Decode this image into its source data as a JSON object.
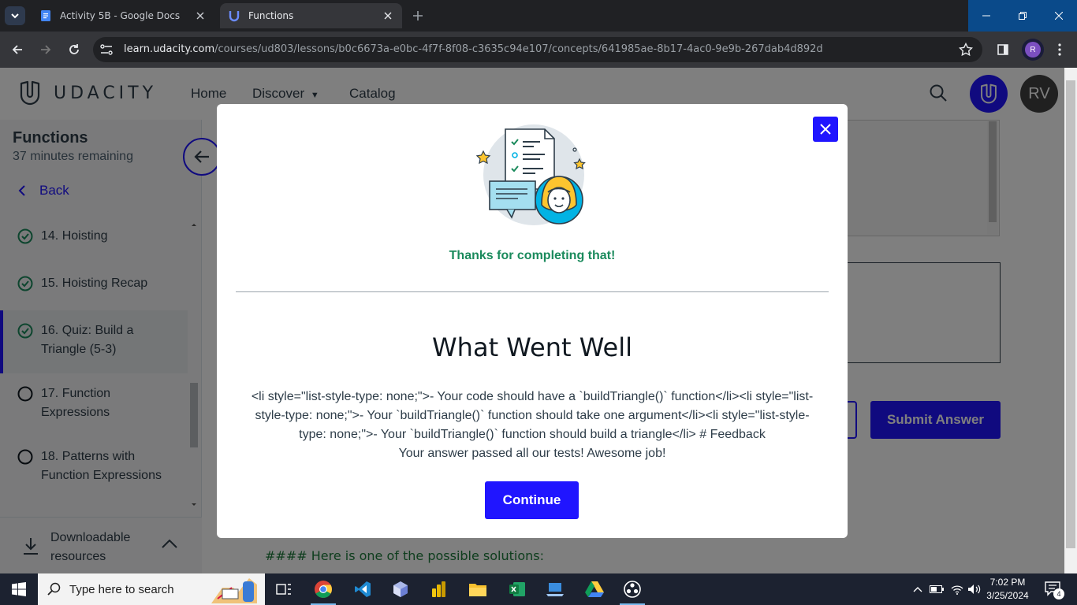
{
  "browser": {
    "tabs": [
      {
        "title": "Activity 5B - Google Docs",
        "active": false
      },
      {
        "title": "Functions",
        "active": true
      }
    ],
    "url": {
      "domain": "learn.udacity.com",
      "path": "/courses/ud803/lessons/b0c6673a-e0bc-4f7f-8f08-c3635c94e107/concepts/641985ae-8b17-4ac0-9e9b-267dab4d892d"
    },
    "profile_initial": "R"
  },
  "site": {
    "logo_text": "UDACITY",
    "nav": {
      "home": "Home",
      "discover": "Discover",
      "catalog": "Catalog"
    },
    "user_initials": "RV"
  },
  "sidebar": {
    "title": "Functions",
    "remaining": "37 minutes remaining",
    "back": "Back",
    "lessons": [
      {
        "label": "14. Hoisting",
        "status": "complete"
      },
      {
        "label": "15. Hoisting Recap",
        "status": "complete"
      },
      {
        "label": "16. Quiz: Build a Triangle (5-3)",
        "status": "complete",
        "current": true
      },
      {
        "label": "17. Function Expressions",
        "status": "incomplete"
      },
      {
        "label": "18. Patterns with Function Expressions",
        "status": "incomplete"
      }
    ],
    "downloads": "Downloadable resources"
  },
  "content": {
    "submit": "Submit Answer",
    "solution_heading": "#### Here is one of the possible solutions:"
  },
  "modal": {
    "thanks": "Thanks for completing that!",
    "heading": "What Went Well",
    "feedback_lines": [
      "<li style=\"list-style-type: none;\">- Your code should have a `buildTriangle()` function</li><li style=\"list-",
      "style-type: none;\">- Your `buildTriangle()` function should take one argument</li><li style=\"list-style-",
      "type: none;\">- Your `buildTriangle()` function should build a triangle</li> # Feedback",
      "Your answer passed all our tests! Awesome job!"
    ],
    "continue": "Continue"
  },
  "taskbar": {
    "search_placeholder": "Type here to search",
    "time": "7:02 PM",
    "date": "3/25/2024",
    "notifications": "4"
  },
  "colors": {
    "accent": "#2015ff",
    "success": "#1a8a5c",
    "dark_text": "#2e3d49"
  }
}
